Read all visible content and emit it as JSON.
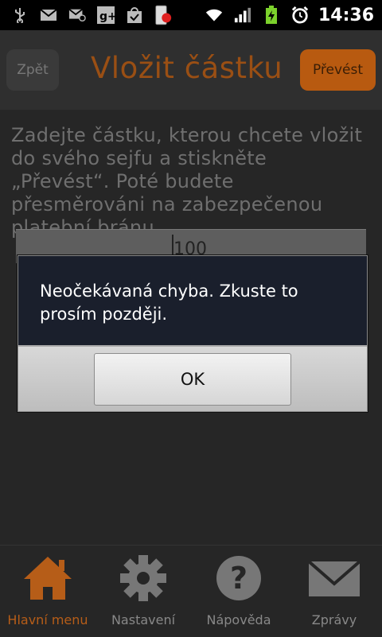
{
  "status_bar": {
    "time": "14:36",
    "icons": [
      "usb-icon",
      "gmail-icon",
      "email-icon",
      "google-plus-icon",
      "shopping-bag-icon",
      "phone-icon",
      "wifi-icon",
      "signal-icon",
      "battery-icon",
      "alarm-icon"
    ]
  },
  "header": {
    "back_label": "Zpět",
    "title": "Vložit částku",
    "convert_label": "Převést"
  },
  "instructions": "Zadejte částku, kterou chcete vložit do svého sejfu a stiskněte „Převést“. Poté budete přesměrováni na zabezpečenou platební bránu.",
  "amount": {
    "value": "100"
  },
  "dialog": {
    "message": "Neočekávaná chyba. Zkuste to prosím později.",
    "ok_label": "OK"
  },
  "bottom_nav": {
    "items": [
      {
        "label": "Hlavní menu",
        "icon": "home-icon",
        "active": true
      },
      {
        "label": "Nastavení",
        "icon": "gear-icon",
        "active": false
      },
      {
        "label": "Nápověda",
        "icon": "help-icon",
        "active": false
      },
      {
        "label": "Zprávy",
        "icon": "envelope-icon",
        "active": false
      }
    ]
  },
  "colors": {
    "accent": "#b85a10",
    "title": "#9a4f14",
    "dialog_bg": "#1a1f2c"
  }
}
